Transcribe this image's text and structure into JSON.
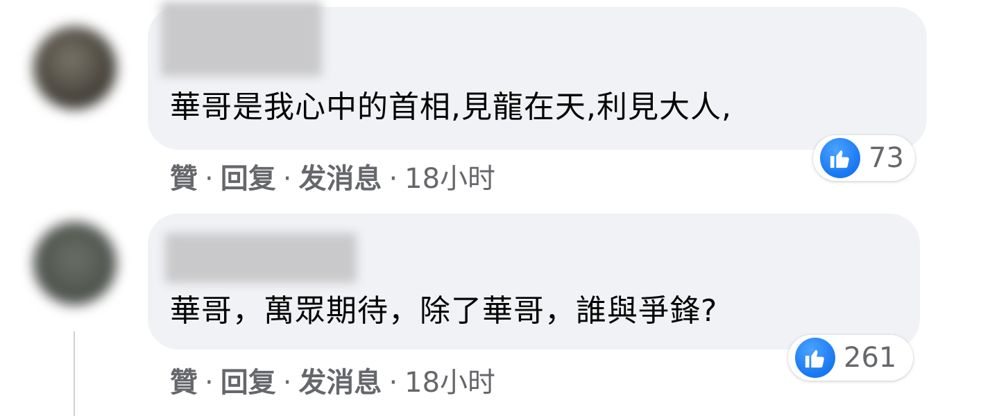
{
  "comments": [
    {
      "text": "華哥是我心中的首相,見龍在天,利見大人,",
      "reactions": {
        "icon": "like-icon",
        "count": "73"
      },
      "actions": {
        "like": "贊",
        "reply": "回复",
        "message": "发消息",
        "time": "18小时"
      }
    },
    {
      "text": "華哥，萬眾期待，除了華哥，誰與爭鋒?",
      "reactions": {
        "icon": "like-icon",
        "count": "261"
      },
      "actions": {
        "like": "贊",
        "reply": "回复",
        "message": "发消息",
        "time": "18小时"
      }
    }
  ],
  "separator": "·",
  "colors": {
    "bubble": "#f0f2f5",
    "like_blue": "#1877f2",
    "meta_text": "#65676b",
    "body_text": "#050505"
  }
}
